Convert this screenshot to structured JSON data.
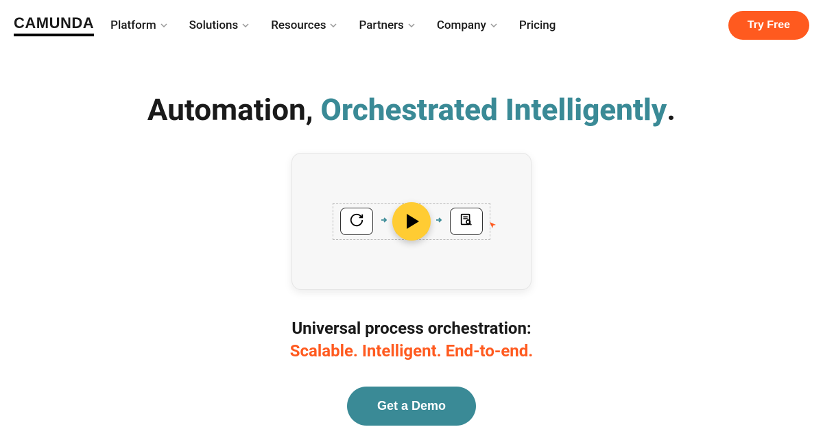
{
  "logo": "CAMUNDA",
  "nav": {
    "items": [
      {
        "label": "Platform",
        "hasDropdown": true
      },
      {
        "label": "Solutions",
        "hasDropdown": true
      },
      {
        "label": "Resources",
        "hasDropdown": true
      },
      {
        "label": "Partners",
        "hasDropdown": true
      },
      {
        "label": "Company",
        "hasDropdown": true
      },
      {
        "label": "Pricing",
        "hasDropdown": false
      }
    ],
    "cta": "Try Free"
  },
  "hero": {
    "title_plain": "Automation, ",
    "title_highlight": "Orchestrated Intelligently",
    "title_suffix": ".",
    "subtitle_line1": "Universal process orchestration:",
    "subtitle_line2": "Scalable. Intelligent. End-to-end.",
    "demo_button": "Get a Demo"
  }
}
